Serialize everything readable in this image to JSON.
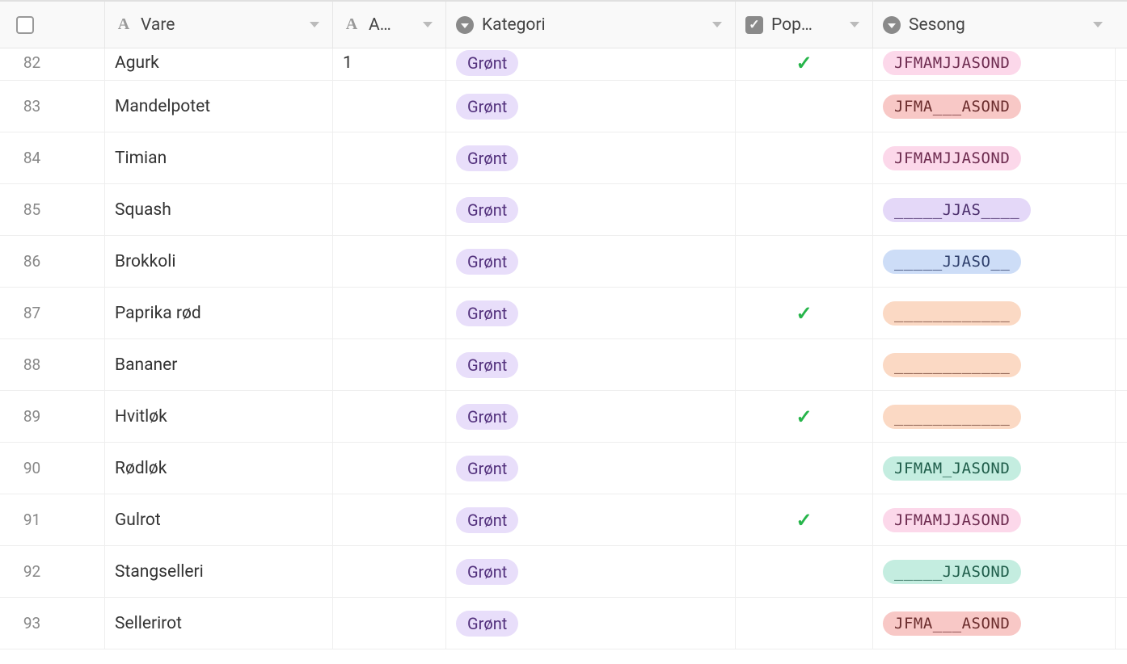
{
  "columns": {
    "vare": "Vare",
    "a": "A…",
    "kategori": "Kategori",
    "pop": "Pop…",
    "sesong": "Sesong"
  },
  "kategori_label": "Grønt",
  "rows": [
    {
      "num": "82",
      "vare": "Agurk",
      "a": "1",
      "pop": true,
      "sesong": "JFMAMJJASOND",
      "sesong_color": "pink"
    },
    {
      "num": "83",
      "vare": "Mandelpotet",
      "a": "",
      "pop": false,
      "sesong": "JFMA___ASOND",
      "sesong_color": "salmon"
    },
    {
      "num": "84",
      "vare": "Timian",
      "a": "",
      "pop": false,
      "sesong": "JFMAMJJASOND",
      "sesong_color": "pink"
    },
    {
      "num": "85",
      "vare": "Squash",
      "a": "",
      "pop": false,
      "sesong": "_____JJAS____",
      "sesong_color": "lav"
    },
    {
      "num": "86",
      "vare": "Brokkoli",
      "a": "",
      "pop": false,
      "sesong": "_____JJASO__",
      "sesong_color": "blue"
    },
    {
      "num": "87",
      "vare": "Paprika rød",
      "a": "",
      "pop": true,
      "sesong": "____________",
      "sesong_color": "peach"
    },
    {
      "num": "88",
      "vare": "Bananer",
      "a": "",
      "pop": false,
      "sesong": "____________",
      "sesong_color": "peach"
    },
    {
      "num": "89",
      "vare": "Hvitløk",
      "a": "",
      "pop": true,
      "sesong": "____________",
      "sesong_color": "peach"
    },
    {
      "num": "90",
      "vare": "Rødløk",
      "a": "",
      "pop": false,
      "sesong": "JFMAM_JASOND",
      "sesong_color": "teal"
    },
    {
      "num": "91",
      "vare": "Gulrot",
      "a": "",
      "pop": true,
      "sesong": "JFMAMJJASOND",
      "sesong_color": "pink"
    },
    {
      "num": "92",
      "vare": "Stangselleri",
      "a": "",
      "pop": false,
      "sesong": "_____JJASOND",
      "sesong_color": "teal"
    },
    {
      "num": "93",
      "vare": "Sellerirot",
      "a": "",
      "pop": false,
      "sesong": "JFMA___ASOND",
      "sesong_color": "salmon"
    }
  ]
}
